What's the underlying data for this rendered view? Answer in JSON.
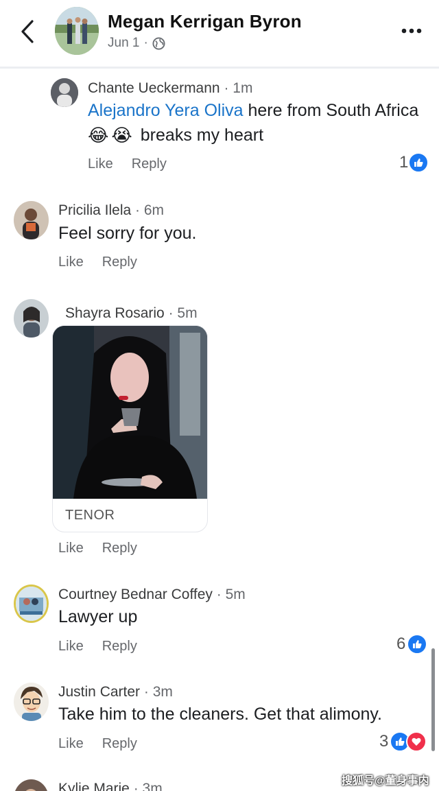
{
  "header": {
    "name": "Megan Kerrigan Byron",
    "date": "Jun 1",
    "separator": "·"
  },
  "comments": [
    {
      "author": "Chante Ueckermann",
      "time": "· 1m",
      "mention": "Alejandro Yera Oliva",
      "text_after_mention": " here from  South Africa",
      "text_line2": "breaks my heart",
      "emoji": [
        "😂",
        "😭"
      ],
      "like_label": "Like",
      "reply_label": "Reply",
      "reaction_count": "1"
    },
    {
      "author": "Pricilia Ilela",
      "time": "· 6m",
      "text": "Feel sorry for you.",
      "like_label": "Like",
      "reply_label": "Reply"
    },
    {
      "author": "Shayra Rosario",
      "time": "· 5m",
      "gif_source": "TENOR",
      "like_label": "Like",
      "reply_label": "Reply"
    },
    {
      "author": "Courtney Bednar Coffey",
      "time": "· 5m",
      "text": "Lawyer up",
      "like_label": "Like",
      "reply_label": "Reply",
      "reaction_count": "6"
    },
    {
      "author": "Justin Carter",
      "time": "· 3m",
      "text": "Take him to the cleaners. Get that alimony.",
      "like_label": "Like",
      "reply_label": "Reply",
      "reaction_count": "3"
    },
    {
      "author": "Kylie Marie",
      "time": "· 3m"
    }
  ],
  "watermark": "搜狐号@董身事内",
  "colors": {
    "mention": "#1a74c9",
    "like_reaction": "#1a78f2",
    "love_reaction": "#f0304b"
  },
  "icons": [
    "back-arrow-icon",
    "globe-icon",
    "more-options-icon",
    "like-reaction-icon",
    "love-reaction-icon"
  ]
}
